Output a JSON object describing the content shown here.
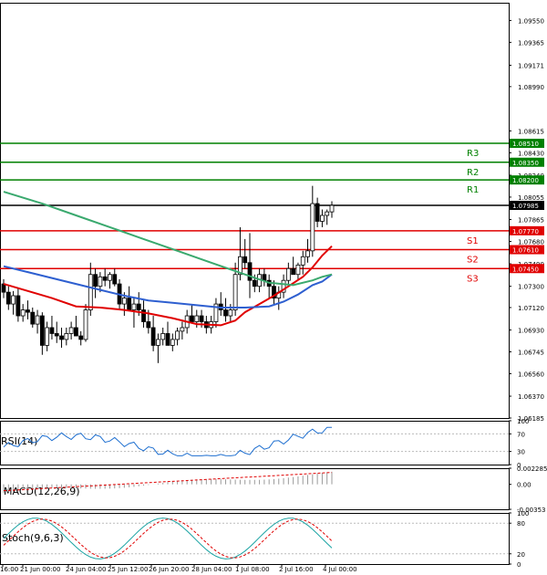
{
  "chart_data": {
    "type": "candlestick",
    "price_axis": {
      "ticks": [
        "1.09550",
        "1.09365",
        "1.09171",
        "1.08990",
        "1.08615",
        "1.08430",
        "1.08240",
        "1.08055",
        "1.07865",
        "1.07680",
        "1.07490",
        "1.07300",
        "1.07120",
        "1.06930",
        "1.06745",
        "1.06560",
        "1.06370",
        "1.06185"
      ],
      "ylim": [
        1.06185,
        1.097
      ]
    },
    "levels": [
      {
        "name": "R3",
        "value": 1.0851,
        "label": "1.08510",
        "color": "#008000"
      },
      {
        "name": "R2",
        "value": 1.0835,
        "label": "1.08350",
        "color": "#008000"
      },
      {
        "name": "R1",
        "value": 1.082,
        "label": "1.08200",
        "color": "#008000"
      },
      {
        "name": "",
        "value": 1.07985,
        "label": "1.07985",
        "color": "#000000"
      },
      {
        "name": "S1",
        "value": 1.0777,
        "label": "1.07770",
        "color": "#e00000"
      },
      {
        "name": "S2",
        "value": 1.0761,
        "label": "1.07610",
        "color": "#e00000"
      },
      {
        "name": "S3",
        "value": 1.0745,
        "label": "1.07450",
        "color": "#e00000"
      }
    ],
    "x_labels": [
      "16:00",
      "21 Jun 00:00",
      "24 Jun 04:00",
      "25 Jun 12:00",
      "26 Jun 20:00",
      "28 Jun 04:00",
      "1 Jul 08:00",
      "2 Jul 16:00",
      "4 Jul 00:00"
    ],
    "candles": [
      [
        1.0732,
        1.0736,
        1.072,
        1.0725
      ],
      [
        1.0725,
        1.073,
        1.071,
        1.0715
      ],
      [
        1.0715,
        1.0726,
        1.0706,
        1.0722
      ],
      [
        1.0722,
        1.0728,
        1.07,
        1.0705
      ],
      [
        1.0705,
        1.0715,
        1.07,
        1.071
      ],
      [
        1.071,
        1.0718,
        1.0702,
        1.0708
      ],
      [
        1.0708,
        1.0712,
        1.0695,
        1.0698
      ],
      [
        1.0698,
        1.071,
        1.069,
        1.0705
      ],
      [
        1.0705,
        1.0708,
        1.0672,
        1.068
      ],
      [
        1.068,
        1.07,
        1.0675,
        1.0695
      ],
      [
        1.0695,
        1.0705,
        1.0685,
        1.069
      ],
      [
        1.069,
        1.07,
        1.0682,
        1.0688
      ],
      [
        1.0688,
        1.0695,
        1.0678,
        1.0685
      ],
      [
        1.0685,
        1.0695,
        1.068,
        1.069
      ],
      [
        1.069,
        1.07,
        1.0685,
        1.0695
      ],
      [
        1.0695,
        1.0705,
        1.069,
        1.0688
      ],
      [
        1.0688,
        1.0692,
        1.068,
        1.0685
      ],
      [
        1.0685,
        1.0715,
        1.0683,
        1.071
      ],
      [
        1.071,
        1.075,
        1.0705,
        1.074
      ],
      [
        1.074,
        1.0745,
        1.072,
        1.073
      ],
      [
        1.073,
        1.0742,
        1.0725,
        1.0738
      ],
      [
        1.0738,
        1.0745,
        1.073,
        1.0735
      ],
      [
        1.0735,
        1.0742,
        1.0728,
        1.074
      ],
      [
        1.074,
        1.0745,
        1.073,
        1.0732
      ],
      [
        1.0732,
        1.0736,
        1.071,
        1.0715
      ],
      [
        1.0715,
        1.0725,
        1.0705,
        1.072
      ],
      [
        1.072,
        1.073,
        1.071,
        1.071
      ],
      [
        1.071,
        1.072,
        1.0695,
        1.0715
      ],
      [
        1.0715,
        1.0725,
        1.0705,
        1.071
      ],
      [
        1.071,
        1.0718,
        1.0695,
        1.07
      ],
      [
        1.07,
        1.071,
        1.069,
        1.0695
      ],
      [
        1.0695,
        1.0705,
        1.0675,
        1.068
      ],
      [
        1.068,
        1.069,
        1.0665,
        1.0685
      ],
      [
        1.0685,
        1.0695,
        1.068,
        1.069
      ],
      [
        1.069,
        1.07,
        1.0685,
        1.068
      ],
      [
        1.068,
        1.069,
        1.0675,
        1.0685
      ],
      [
        1.0685,
        1.0695,
        1.068,
        1.0692
      ],
      [
        1.0692,
        1.07,
        1.0685,
        1.0695
      ],
      [
        1.0695,
        1.071,
        1.069,
        1.0705
      ],
      [
        1.0705,
        1.0715,
        1.07,
        1.07
      ],
      [
        1.07,
        1.071,
        1.0695,
        1.0705
      ],
      [
        1.0705,
        1.071,
        1.0695,
        1.07
      ],
      [
        1.07,
        1.0705,
        1.069,
        1.0695
      ],
      [
        1.0695,
        1.0705,
        1.069,
        1.07
      ],
      [
        1.07,
        1.072,
        1.0695,
        1.0715
      ],
      [
        1.0715,
        1.0725,
        1.0705,
        1.071
      ],
      [
        1.071,
        1.072,
        1.07,
        1.0705
      ],
      [
        1.0705,
        1.0715,
        1.07,
        1.071
      ],
      [
        1.071,
        1.075,
        1.0705,
        1.074
      ],
      [
        1.074,
        1.078,
        1.0735,
        1.0755
      ],
      [
        1.0755,
        1.077,
        1.0745,
        1.075
      ],
      [
        1.075,
        1.0775,
        1.072,
        1.0735
      ],
      [
        1.0735,
        1.074,
        1.0725,
        1.073
      ],
      [
        1.073,
        1.0745,
        1.0725,
        1.074
      ],
      [
        1.074,
        1.0745,
        1.073,
        1.0735
      ],
      [
        1.0735,
        1.074,
        1.072,
        1.073
      ],
      [
        1.073,
        1.0735,
        1.0715,
        1.072
      ],
      [
        1.072,
        1.073,
        1.071,
        1.0725
      ],
      [
        1.0725,
        1.074,
        1.072,
        1.0735
      ],
      [
        1.0735,
        1.075,
        1.073,
        1.0745
      ],
      [
        1.0745,
        1.0755,
        1.074,
        1.074
      ],
      [
        1.074,
        1.075,
        1.0735,
        1.0748
      ],
      [
        1.0748,
        1.076,
        1.074,
        1.0755
      ],
      [
        1.0755,
        1.077,
        1.075,
        1.076
      ],
      [
        1.076,
        1.0815,
        1.0755,
        1.08
      ],
      [
        1.08,
        1.0805,
        1.078,
        1.0785
      ],
      [
        1.0785,
        1.0795,
        1.078,
        1.079
      ],
      [
        1.079,
        1.0795,
        1.0782,
        1.0793
      ],
      [
        1.0793,
        1.0802,
        1.0788,
        1.07985
      ]
    ],
    "series": [
      {
        "name": "",
        "color": "#e00000",
        "values": [
          [
            0,
            1.0732
          ],
          [
            5,
            1.0726
          ],
          [
            10,
            1.072
          ],
          [
            15,
            1.0713
          ],
          [
            20,
            1.0712
          ],
          [
            25,
            1.071
          ],
          [
            30,
            1.0707
          ],
          [
            35,
            1.0703
          ],
          [
            40,
            1.0698
          ],
          [
            45,
            1.0697
          ],
          [
            48,
            1.0701
          ],
          [
            50,
            1.0708
          ],
          [
            53,
            1.0715
          ],
          [
            56,
            1.0722
          ],
          [
            59,
            1.073
          ],
          [
            62,
            1.0738
          ],
          [
            64,
            1.0746
          ],
          [
            66,
            1.0756
          ],
          [
            68,
            1.0764
          ]
        ]
      },
      {
        "name": "",
        "color": "#2e5fd0",
        "values": [
          [
            0,
            1.0747
          ],
          [
            5,
            1.0742
          ],
          [
            10,
            1.0737
          ],
          [
            15,
            1.0732
          ],
          [
            20,
            1.0727
          ],
          [
            25,
            1.0722
          ],
          [
            30,
            1.0718
          ],
          [
            35,
            1.0716
          ],
          [
            40,
            1.0714
          ],
          [
            45,
            1.0712
          ],
          [
            50,
            1.0712
          ],
          [
            55,
            1.0713
          ],
          [
            58,
            1.0717
          ],
          [
            61,
            1.0723
          ],
          [
            64,
            1.0731
          ],
          [
            66,
            1.0734
          ],
          [
            68,
            1.074
          ]
        ]
      },
      {
        "name": "",
        "color": "#3aa96e",
        "values": [
          [
            0,
            1.081
          ],
          [
            8,
            1.08
          ],
          [
            15,
            1.079
          ],
          [
            22,
            1.078
          ],
          [
            29,
            1.077
          ],
          [
            36,
            1.076
          ],
          [
            43,
            1.075
          ],
          [
            50,
            1.074
          ],
          [
            55,
            1.0733
          ],
          [
            60,
            1.0731
          ],
          [
            64,
            1.0735
          ],
          [
            66,
            1.0738
          ],
          [
            68,
            1.074
          ]
        ]
      }
    ]
  },
  "rsi": {
    "label": "RSI(14)",
    "ticks": [
      "100",
      "70",
      "30",
      "0"
    ]
  },
  "macd": {
    "label": "MACD(12,26,9)",
    "ticks": [
      "0.002285",
      "0.00",
      "-0.00353"
    ]
  },
  "stoch": {
    "label": "Stoch(9,6,3)",
    "ticks": [
      "100",
      "80",
      "20",
      "0"
    ]
  }
}
